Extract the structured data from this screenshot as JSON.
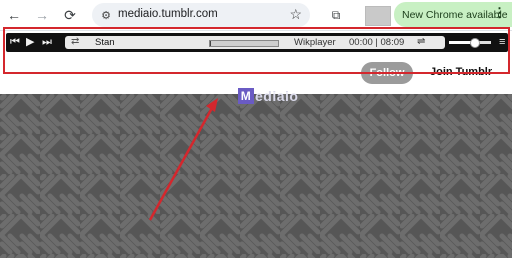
{
  "browser": {
    "url": "mediaio.tumblr.com",
    "update_label": "New Chrome available"
  },
  "player": {
    "track_title": "Stan",
    "brand": "Wikplayer",
    "time": "00:00 | 08:09",
    "progress": 0.02,
    "volume": 0.6
  },
  "tumblr": {
    "follow_label": "Follow",
    "join_label": "Join Tumblr"
  },
  "watermark": {
    "logo_letter": "M",
    "text": "ediaio"
  },
  "colors": {
    "highlight": "#d4272d",
    "update_pill": "#c8f0c3",
    "player_bg": "#111111",
    "pattern_bg": "#565656"
  }
}
